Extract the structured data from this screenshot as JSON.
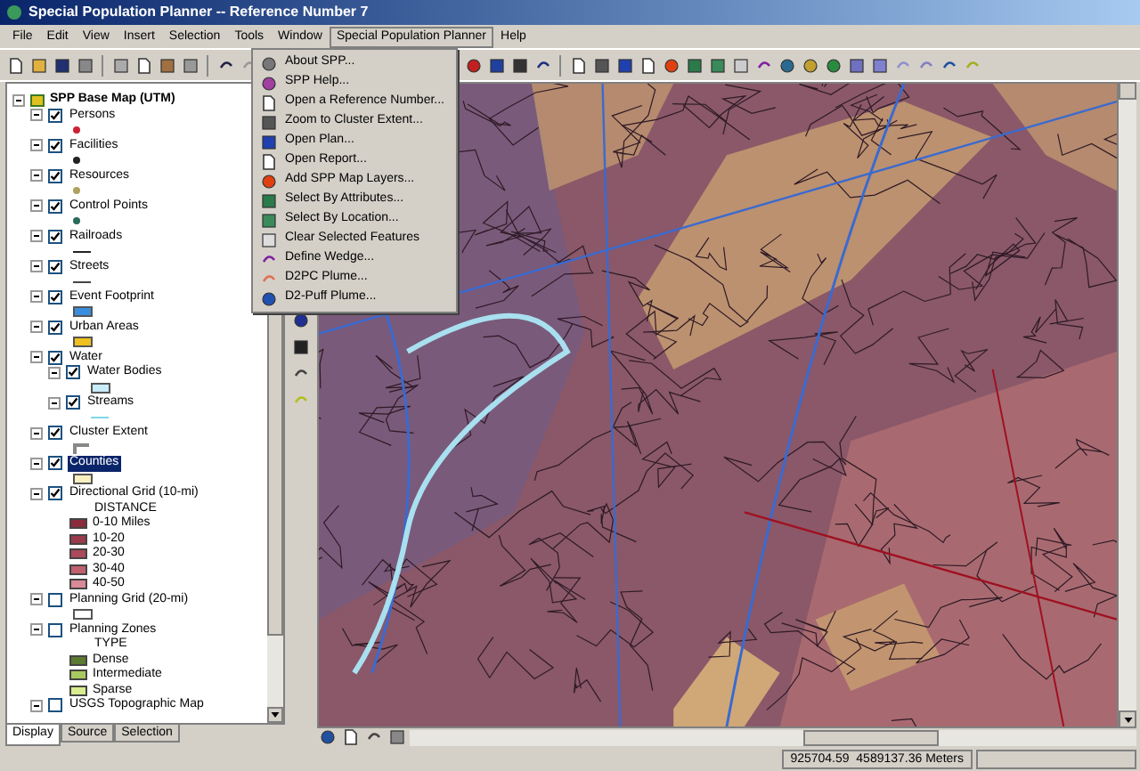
{
  "window": {
    "title": "Special Population Planner -- Reference Number 7"
  },
  "menu_bar": [
    {
      "label": "File",
      "open": false
    },
    {
      "label": "Edit",
      "open": false
    },
    {
      "label": "View",
      "open": false
    },
    {
      "label": "Insert",
      "open": false
    },
    {
      "label": "Selection",
      "open": false
    },
    {
      "label": "Tools",
      "open": false
    },
    {
      "label": "Window",
      "open": false
    },
    {
      "label": "Special Population Planner",
      "open": true
    },
    {
      "label": "Help",
      "open": false
    }
  ],
  "dropdown_menu": [
    "About SPP...",
    "SPP Help...",
    "Open a Reference Number...",
    "Zoom to Cluster Extent...",
    "Open Plan...",
    "Open Report...",
    "Add SPP Map Layers...",
    "Select By Attributes...",
    "Select By Location...",
    "Clear Selected Features",
    "Define Wedge...",
    "D2PC Plume...",
    "D2-Puff Plume..."
  ],
  "toc": {
    "root": {
      "label": "SPP Base Map (UTM)",
      "expanded": true,
      "layers": [
        {
          "label": "Persons",
          "checked": true,
          "selected": false,
          "expanded": true,
          "legend": {
            "kind": "point",
            "color": "#cc2233"
          }
        },
        {
          "label": "Facilities",
          "checked": true,
          "selected": false,
          "expanded": true,
          "legend": {
            "kind": "point",
            "color": "#222222"
          }
        },
        {
          "label": "Resources",
          "checked": true,
          "selected": false,
          "expanded": true,
          "legend": {
            "kind": "point",
            "color": "#b0a060"
          }
        },
        {
          "label": "Control Points",
          "checked": true,
          "selected": false,
          "expanded": true,
          "legend": {
            "kind": "point",
            "color": "#2a6a5a"
          }
        },
        {
          "label": "Railroads",
          "checked": true,
          "selected": false,
          "expanded": true,
          "legend": {
            "kind": "line",
            "color": "#222222"
          }
        },
        {
          "label": "Streets",
          "checked": true,
          "selected": false,
          "expanded": true,
          "legend": {
            "kind": "line",
            "color": "#444444"
          }
        },
        {
          "label": "Event Footprint",
          "checked": true,
          "selected": false,
          "expanded": true,
          "legend": {
            "kind": "fill",
            "color": "#3a8ee0"
          }
        },
        {
          "label": "Urban Areas",
          "checked": true,
          "selected": false,
          "expanded": true,
          "legend": {
            "kind": "fill",
            "color": "#f0c020"
          }
        },
        {
          "label": "Water",
          "checked": true,
          "selected": false,
          "expanded": true,
          "children": [
            {
              "label": "Water Bodies",
              "checked": true,
              "selected": false,
              "expanded": true,
              "legend": {
                "kind": "fill",
                "color": "#c8ecf8"
              }
            },
            {
              "label": "Streams",
              "checked": true,
              "selected": false,
              "expanded": true,
              "legend": {
                "kind": "line",
                "color": "#80d8e8"
              }
            }
          ]
        },
        {
          "label": "Cluster Extent",
          "checked": true,
          "selected": false,
          "expanded": true,
          "legend": {
            "kind": "cluster",
            "color": "#888888"
          }
        },
        {
          "label": "Counties",
          "checked": true,
          "selected": true,
          "expanded": true,
          "legend": {
            "kind": "fill",
            "color": "#f8f0c0"
          }
        },
        {
          "label": "Directional Grid (10-mi)",
          "checked": true,
          "selected": false,
          "expanded": true,
          "classes": {
            "heading": "DISTANCE",
            "items": [
              {
                "label": "0-10 Miles",
                "color": "#8a2a3a"
              },
              {
                "label": "10-20",
                "color": "#9a3a4a"
              },
              {
                "label": "20-30",
                "color": "#aa4a5a"
              },
              {
                "label": "30-40",
                "color": "#c0606e"
              },
              {
                "label": "40-50",
                "color": "#d88a96"
              }
            ]
          }
        },
        {
          "label": "Planning Grid (20-mi)",
          "checked": false,
          "selected": false,
          "expanded": true,
          "legend": {
            "kind": "fill",
            "color": "#ffffff"
          }
        },
        {
          "label": "Planning Zones",
          "checked": false,
          "selected": false,
          "expanded": true,
          "classes": {
            "heading": "TYPE",
            "items": [
              {
                "label": "Dense",
                "color": "#5a7a30"
              },
              {
                "label": "Intermediate",
                "color": "#a8c860"
              },
              {
                "label": "Sparse",
                "color": "#d8ec90"
              }
            ]
          }
        },
        {
          "label": "USGS Topographic Map",
          "checked": false,
          "selected": false,
          "expanded": true
        }
      ]
    }
  },
  "toc_tabs": [
    {
      "label": "Display",
      "selected": true
    },
    {
      "label": "Source",
      "selected": false
    },
    {
      "label": "Selection",
      "selected": false
    }
  ],
  "status_bar": {
    "coordinates": "925704.59  4589137.36 Meters"
  }
}
